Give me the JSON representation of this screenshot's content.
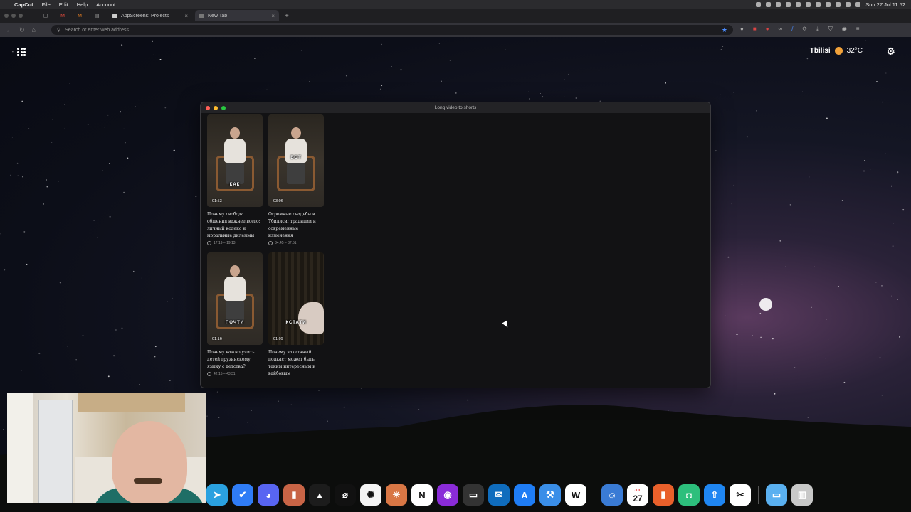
{
  "menubar": {
    "app_name": "CapCut",
    "menus": [
      "File",
      "Edit",
      "Help",
      "Account"
    ],
    "datetime": "Sun 27 Jul  11:52"
  },
  "browser": {
    "tabs": [
      {
        "label": "AppScreens: Projects",
        "active": false
      },
      {
        "label": "New Tab",
        "active": true
      }
    ],
    "address_placeholder": "Search or enter web address"
  },
  "newtab": {
    "city": "Tbilisi",
    "temperature": "32°C"
  },
  "app_window": {
    "title": "Long video to shorts",
    "cards": [
      {
        "caption": "КАК",
        "duration": "01:53",
        "title": "Почему свобода общения важнее всего: личный кодекс и моральные дилеммы",
        "range": "17:19 – 19:13",
        "style": "person",
        "caption_pos": "mid"
      },
      {
        "caption": "ВОТ",
        "duration": "03:06",
        "title": "Огромные свадьбы в Тбилиси: традиции и современные изменения",
        "range": "34:45 – 37:51",
        "style": "person",
        "caption_pos": "top"
      },
      {
        "caption": "ПОЧТИ",
        "duration": "01:16",
        "title": "Почему важно учить детей грузинскому языку с детства?",
        "range": "42:15 – 43:31",
        "style": "person",
        "caption_pos": "mid"
      },
      {
        "caption": "КСТАТИ",
        "duration": "01:09",
        "title": "Почему закетчный подкаст может быть таким интересным и вайбовым",
        "range": "",
        "style": "curtain",
        "caption_pos": "mid"
      }
    ]
  },
  "dock": {
    "apps": [
      "telegram-icon",
      "tasks-icon",
      "discord-icon",
      "editor-icon",
      "affinity-icon",
      "cursor-icon",
      "chatgpt-icon",
      "claude-icon",
      "notion-icon",
      "github-icon",
      "terminal-icon",
      "outlook-icon",
      "appstore-connect-icon",
      "xcode-icon",
      "webflow-icon",
      "finder-icon",
      "calendar-icon",
      "bar-chart-icon",
      "chat-icon",
      "transporter-icon",
      "capcut-icon",
      "folder-icon",
      "trash-icon"
    ],
    "calendar_month": "JUL",
    "calendar_day": "27"
  }
}
